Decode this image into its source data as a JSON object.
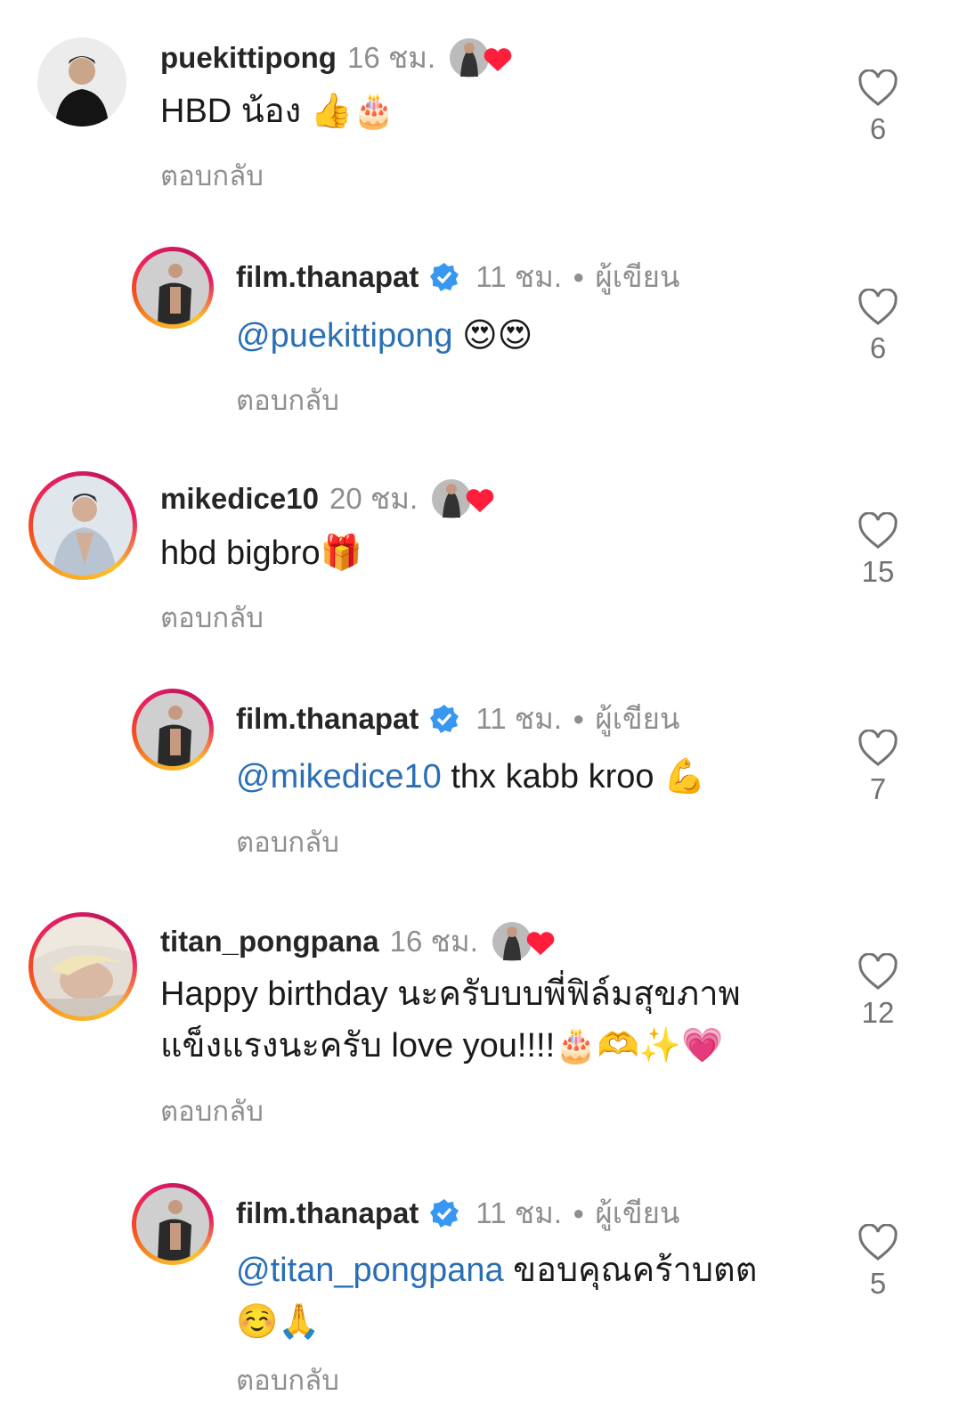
{
  "comments": [
    {
      "username": "puekittipong",
      "time": "16 ชม.",
      "text": "HBD น้อง ",
      "emoji": "👍🎂",
      "reply_label": "ตอบกลับ",
      "likes": "6"
    },
    {
      "username": "film.thanapat",
      "time": "11 ชม.",
      "author_label": "ผู้เขียน",
      "mention": "@puekittipong",
      "text": " ",
      "emoji": "😍😍",
      "reply_label": "ตอบกลับ",
      "likes": "6"
    },
    {
      "username": "mikedice10",
      "time": "20 ชม.",
      "text": "hbd bigbro",
      "emoji": "🎁",
      "reply_label": "ตอบกลับ",
      "likes": "15"
    },
    {
      "username": "film.thanapat",
      "time": "11 ชม.",
      "author_label": "ผู้เขียน",
      "mention": "@mikedice10",
      "text": " thx kabb kroo ",
      "emoji": "💪",
      "reply_label": "ตอบกลับ",
      "likes": "7"
    },
    {
      "username": "titan_pongpana",
      "time": "16 ชม.",
      "line1": "Happy birthday นะครับบบพี่ฟิล์มสุขภาพ",
      "line2": "แข็งแรงนะครับ love you!!!!",
      "emoji": "🎂🫶✨💗",
      "reply_label": "ตอบกลับ",
      "likes": "12"
    },
    {
      "username": "film.thanapat",
      "time": "11 ชม.",
      "author_label": "ผู้เขียน",
      "mention": "@titan_pongpana",
      "text": " ขอบคุณคร้าบตต",
      "emoji": "☺️🙏",
      "reply_label": "ตอบกลับ",
      "likes": "5"
    }
  ],
  "colors": {
    "mention": "#2a6fb5",
    "verified": "#3897f0",
    "liked_heart": "#ff1f3d",
    "meta_gray": "#8e8e8e"
  },
  "icons": [
    "heart-outline-icon",
    "verified-badge-icon",
    "creator-liked-heart-icon"
  ]
}
